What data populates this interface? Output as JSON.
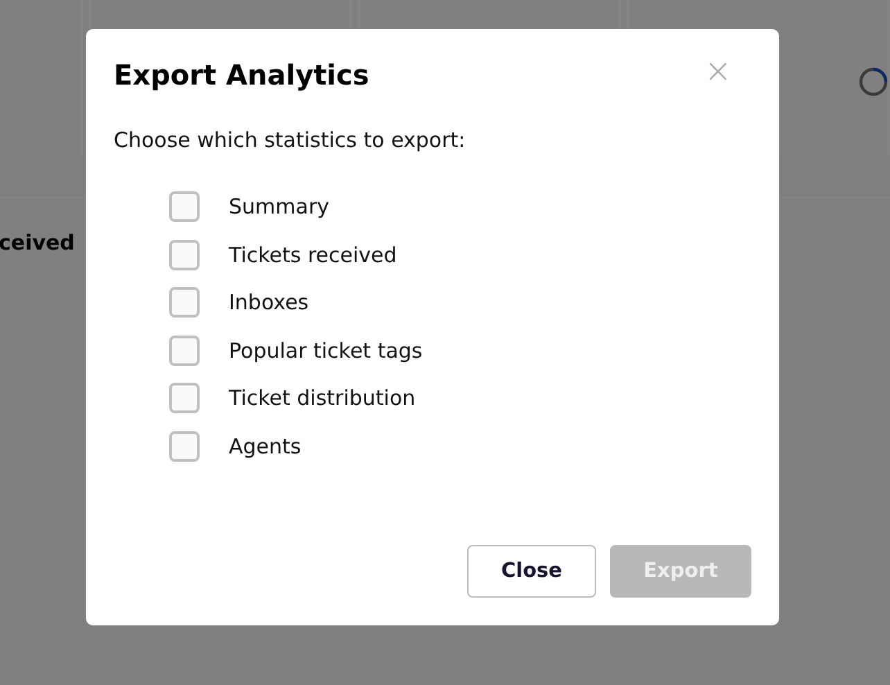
{
  "background": {
    "heading": "ceived",
    "loading": true
  },
  "dialog": {
    "title": "Export Analytics",
    "close_icon": "×",
    "prompt": "Choose which statistics to export:",
    "options": [
      {
        "label": "Summary",
        "checked": false
      },
      {
        "label": "Tickets received",
        "checked": false
      },
      {
        "label": "Inboxes",
        "checked": false
      },
      {
        "label": "Popular ticket tags",
        "checked": false
      },
      {
        "label": "Ticket distribution",
        "checked": false
      },
      {
        "label": "Agents",
        "checked": false
      }
    ],
    "buttons": [
      {
        "label": "Close",
        "disabled": false,
        "kind": "secondary"
      },
      {
        "label": "Export",
        "disabled": true,
        "kind": "primary"
      }
    ]
  }
}
